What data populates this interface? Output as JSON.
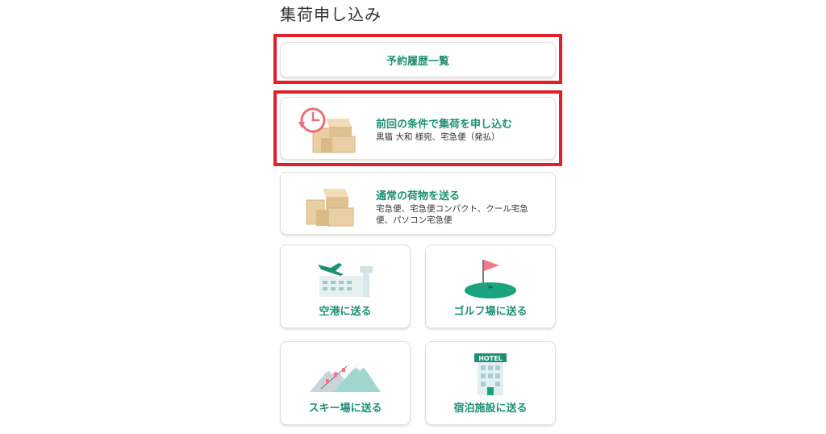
{
  "page": {
    "title": "集荷申し込み"
  },
  "history_button": {
    "label": "予約履歴一覧"
  },
  "repeat_card": {
    "title": "前回の条件で集荷を申し込む",
    "subtitle": "黒猫 大和 様宛、宅急便（発払）",
    "icon": "history-clock-boxes-icon"
  },
  "normal_card": {
    "title": "通常の荷物を送る",
    "subtitle": "宅急便、宅急便コンパクト、クール宅急便、パソコン宅急便",
    "icon": "boxes-icon"
  },
  "tiles": [
    {
      "label": "空港に送る",
      "icon": "airport-icon"
    },
    {
      "label": "ゴルフ場に送る",
      "icon": "golf-flag-icon"
    },
    {
      "label": "スキー場に送る",
      "icon": "ski-mountain-icon"
    },
    {
      "label": "宿泊施設に送る",
      "icon": "hotel-icon",
      "sign_text": "HOTEL"
    }
  ],
  "colors": {
    "accent_green": "#1e8f74",
    "highlight_red": "#e31f26",
    "box_tan": "#e9cfa3",
    "clock_pink": "#e8707a"
  }
}
